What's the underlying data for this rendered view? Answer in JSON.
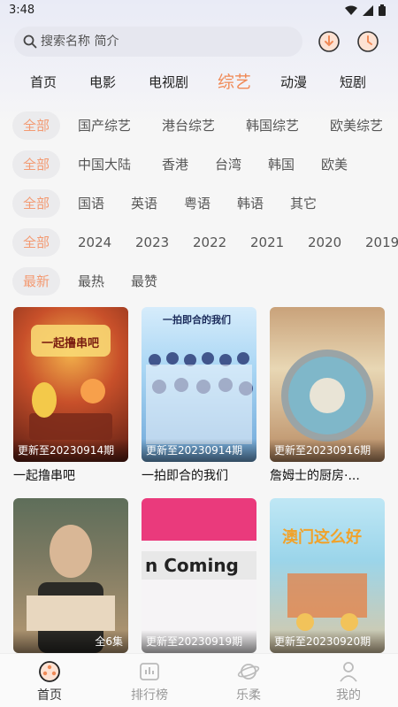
{
  "status": {
    "time": "3:48"
  },
  "search": {
    "placeholder": "搜索名称 简介"
  },
  "nav_tabs": [
    "首页",
    "电影",
    "电视剧",
    "综艺",
    "动漫",
    "短剧"
  ],
  "nav_active": "综艺",
  "filters": {
    "type": {
      "selected": "全部",
      "options": [
        "国产综艺",
        "港台综艺",
        "韩国综艺",
        "欧美综艺"
      ]
    },
    "region": {
      "selected": "全部",
      "options": [
        "中国大陆",
        "香港",
        "台湾",
        "韩国",
        "欧美"
      ]
    },
    "language": {
      "selected": "全部",
      "options": [
        "国语",
        "英语",
        "粤语",
        "韩语",
        "其它"
      ]
    },
    "year": {
      "selected": "全部",
      "options": [
        "2024",
        "2023",
        "2022",
        "2021",
        "2020",
        "2019"
      ]
    },
    "sort": {
      "selected": "最新",
      "options": [
        "最热",
        "最赞"
      ]
    }
  },
  "cards": [
    {
      "title": "一起撸串吧",
      "badge": "更新至20230914期",
      "poster_text": "一起撸串吧"
    },
    {
      "title": "一拍即合的我们",
      "badge": "更新至20230914期",
      "poster_text": "一拍即合的我们"
    },
    {
      "title": "詹姆士的厨房·...",
      "badge": "更新至20230916期",
      "poster_text": ""
    },
    {
      "title": "",
      "badge": "全6集",
      "poster_text": ""
    },
    {
      "title": "",
      "badge": "更新至20230919期",
      "poster_text": "n Coming"
    },
    {
      "title": "",
      "badge": "更新至20230920期",
      "poster_text": "澳门这么好"
    }
  ],
  "bottom_nav": [
    "首页",
    "排行榜",
    "乐柔",
    "我的"
  ],
  "colors": {
    "accent": "#f08a57",
    "chip_selected_text": "#f39a72"
  }
}
